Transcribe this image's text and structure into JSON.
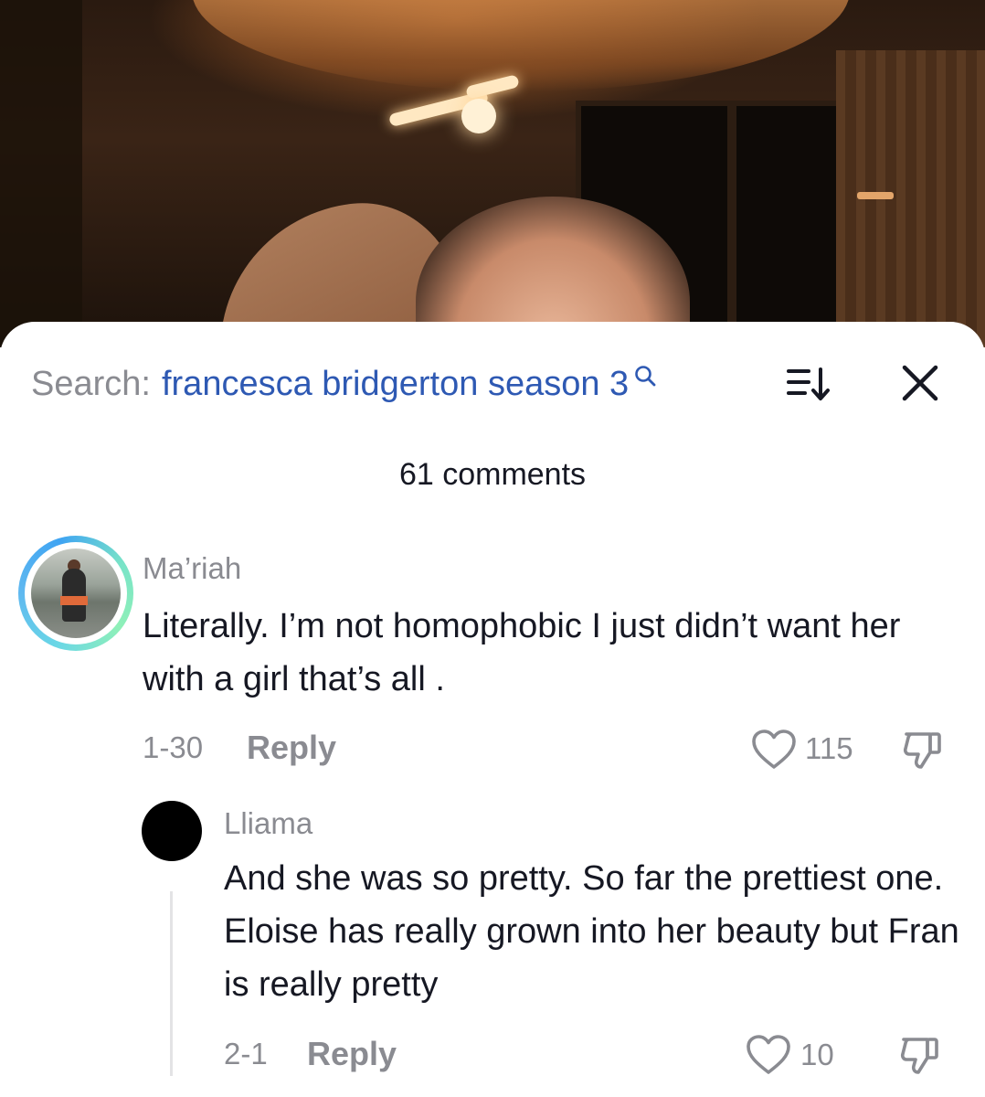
{
  "search": {
    "prefix": "Search:",
    "query": "francesca bridgerton season 3"
  },
  "header": {
    "comment_count": "61 comments"
  },
  "comments": [
    {
      "username": "Ma’riah",
      "text": "Literally. I’m not homophobic I just didn’t want her with a girl that’s all .",
      "date": "1-30",
      "reply_label": "Reply",
      "likes": "115"
    },
    {
      "username": "Lliama",
      "text": "And she was so pretty. So far the prettiest one. Eloise has really grown into her beauty but Fran is really pretty",
      "date": "2-1",
      "reply_label": "Reply",
      "likes": "10"
    }
  ],
  "icons": {
    "search": "search-icon",
    "sort": "sort-icon",
    "close": "close-icon",
    "like": "heart-icon",
    "dislike": "thumbs-down-icon"
  },
  "colors": {
    "search_query": "#2e59b3",
    "muted_text": "#8a8b91",
    "body_text": "#161823"
  }
}
